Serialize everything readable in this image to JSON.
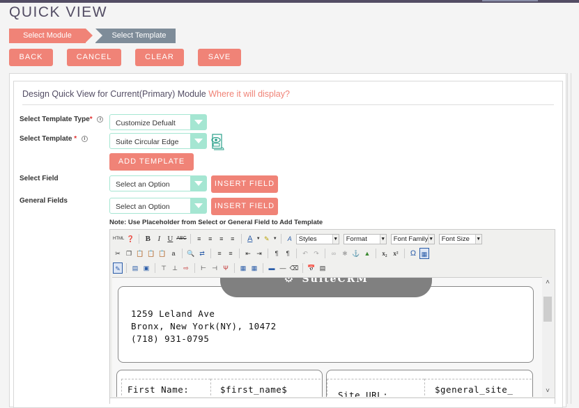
{
  "page": {
    "title": "QUICK VIEW"
  },
  "steps": [
    {
      "label": "Select Module",
      "state": "completed"
    },
    {
      "label": "Select Template",
      "state": "active"
    }
  ],
  "actions": {
    "back": "BACK",
    "cancel": "CANCEL",
    "clear": "CLEAR",
    "save": "SAVE"
  },
  "colors": {
    "accent": "#f08377",
    "step_active": "#7e8c99",
    "select_accent": "#a5e6d2",
    "title": "#534d64"
  },
  "form": {
    "heading": "Design Quick View for Current(Primary) Module",
    "heading_link": "Where it will display?",
    "template_type": {
      "label": "Select Template Type",
      "required": "*",
      "value": "Customize Defualt"
    },
    "template": {
      "label": "Select Template",
      "required": "*",
      "value": "Suite Circular Edge"
    },
    "add_template": "ADD TEMPLATE",
    "select_field": {
      "label": "Select Field",
      "value": "Select an Option",
      "button": "INSERT FIELD"
    },
    "general_fields": {
      "label": "General Fields",
      "value": "Select an Option",
      "button": "INSERT FIELD"
    },
    "note": "Note: Use Placeholder from Select or General Field to Add Template"
  },
  "editor": {
    "toolbar": {
      "html": "HTML",
      "styles": "Styles",
      "format": "Format",
      "font_family": "Font Family",
      "font_size": "Font Size"
    },
    "content": {
      "logo_text": "SuiteCRM",
      "address_lines": [
        "1259 Leland Ave",
        "Bronx, New York(NY), 10472",
        "(718) 931-0795"
      ],
      "fields": [
        {
          "label": "First Name:",
          "placeholder": "$first_name$"
        },
        {
          "label": "Site URL:",
          "placeholder": "$general_site_"
        }
      ]
    }
  }
}
